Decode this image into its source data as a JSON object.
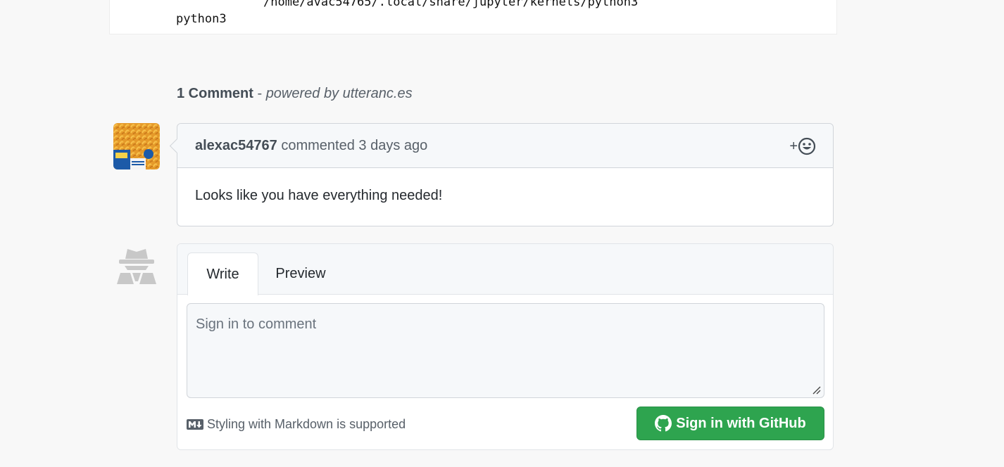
{
  "code": {
    "kernel_name": "python3",
    "kernel_path": "/home/avac54765/.local/share/jupyter/kernels/python3"
  },
  "comments": {
    "count_label": "1 Comment",
    "separator": " - ",
    "powered_prefix": "powered by ",
    "powered_link": "utteranc.es",
    "items": [
      {
        "author": "alexac54767",
        "action": " commented ",
        "time": "3 days ago",
        "body": "Looks like you have everything needed!",
        "reaction_label": "+"
      }
    ]
  },
  "form": {
    "tabs": [
      "Write",
      "Preview"
    ],
    "placeholder": "Sign in to comment",
    "markdown_note": "Styling with Markdown is supported",
    "signin_label": "Sign in with GitHub"
  },
  "icons": {
    "reaction": "smiley-icon",
    "markdown": "markdown-icon",
    "github": "github-mark-icon",
    "anonymous": "anonymous-user-icon"
  },
  "colors": {
    "primary_button": "#2ea44f",
    "header_bg": "#f6f8fa",
    "border": "#d1d5da"
  }
}
